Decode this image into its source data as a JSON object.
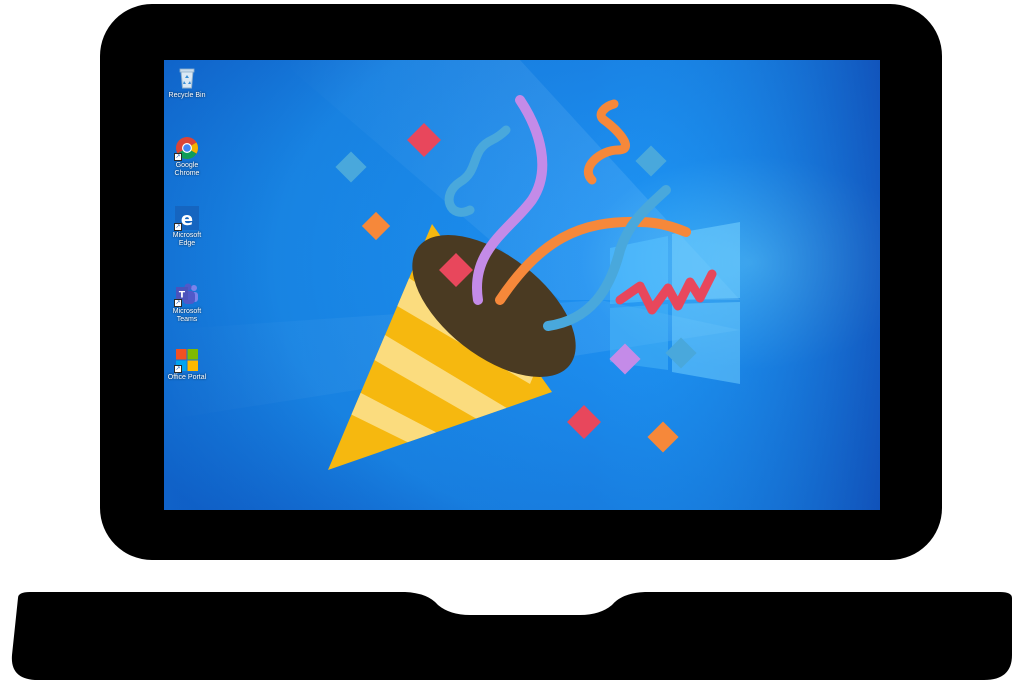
{
  "desktop": {
    "icons": [
      {
        "name": "recycle-bin",
        "label": "Recycle Bin",
        "icon": "recycle-bin-icon"
      },
      {
        "name": "google-chrome",
        "label": "Google Chrome",
        "icon": "chrome-icon"
      },
      {
        "name": "microsoft-edge",
        "label": "Microsoft Edge",
        "icon": "edge-icon"
      },
      {
        "name": "microsoft-teams",
        "label": "Microsoft Teams",
        "icon": "teams-icon"
      },
      {
        "name": "office-portal",
        "label": "Office Portal",
        "icon": "office-icon"
      }
    ],
    "wallpaper": "windows-10-default",
    "overlay": "party-popper-emoji"
  },
  "colors": {
    "bezel": "#000000",
    "wallpaper_light": "#1a9bf0",
    "wallpaper_dark": "#0a3fb0",
    "popper_yellow": "#f6b80f",
    "popper_stripe": "#fbdc7e",
    "popper_mouth": "#4a3a22",
    "confetti_red": "#e8475c",
    "confetti_orange": "#f6883a",
    "confetti_blue": "#49a8dc",
    "confetti_purple": "#c48be8"
  }
}
